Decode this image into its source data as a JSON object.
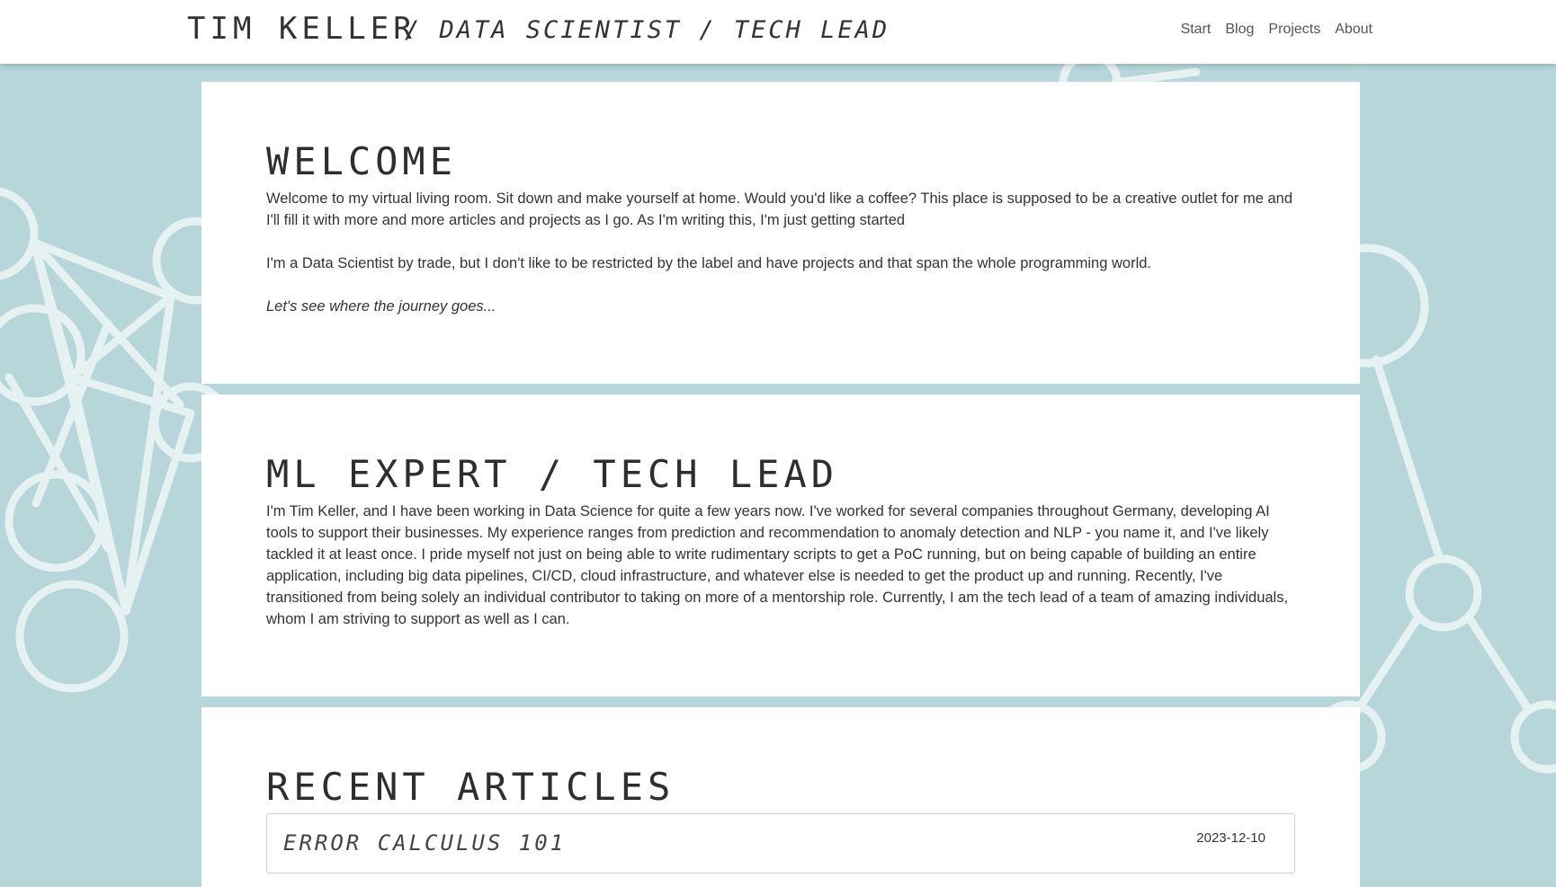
{
  "header": {
    "brand": "TIM KELLER",
    "tagline": "/ DATA SCIENTIST / TECH LEAD",
    "nav": [
      {
        "label": "Start"
      },
      {
        "label": "Blog"
      },
      {
        "label": "Projects"
      },
      {
        "label": "About"
      }
    ]
  },
  "welcome": {
    "title": "WELCOME",
    "p1": "Welcome to my virtual living room. Sit down and make yourself at home. Would you'd like a coffee? This place is supposed to be a creative outlet for me and I'll fill it with more and more articles and projects as I go. As I'm writing this, I'm just getting started",
    "p2": "I'm a Data Scientist by trade, but I don't like to be restricted by the label and have projects and that span the whole programming world.",
    "p3": "Let's see where the journey goes..."
  },
  "expert": {
    "title": "ML EXPERT / TECH LEAD",
    "p1": "I'm Tim Keller, and I have been working in Data Science for quite a few years now. I've worked for several companies throughout Germany, developing AI tools to support their businesses. My experience ranges from prediction and recommendation to anomaly detection and NLP - you name it, and I've likely tackled it at least once. I pride myself not just on being able to write rudimentary scripts to get a PoC running, but on being capable of building an entire application, including big data pipelines, CI/CD, cloud infrastructure, and whatever else is needed to get the product up and running. Recently, I've transitioned from being solely an individual contributor to taking on more of a mentorship role. Currently, I am the tech lead of a team of amazing individuals, whom I am striving to support as well as I can."
  },
  "articles": {
    "title": "RECENT ARTICLES",
    "items": [
      {
        "title": "ERROR CALCULUS 101",
        "date": "2023-12-10"
      }
    ]
  },
  "colors": {
    "background": "#b6d6da",
    "card": "#ffffff",
    "text": "#333333"
  }
}
